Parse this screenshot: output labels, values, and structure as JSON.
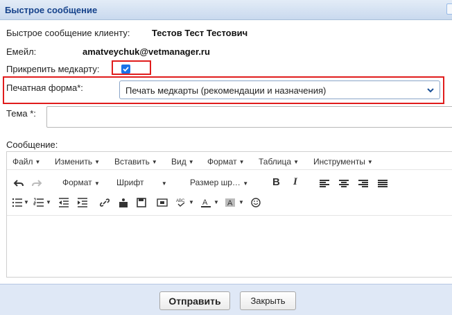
{
  "window": {
    "title": "Быстрое сообщение"
  },
  "form": {
    "client_label": "Быстрое сообщение клиенту:",
    "client_name": "Тестов Тест Тестович",
    "email_label": "Емейл:",
    "email_value": "amatveychuk@vetmanager.ru",
    "attach_label": "Прикрепить медкарту:",
    "attach_checked": true,
    "print_form_label": "Печатная форма*:",
    "print_form_value": "Печать медкарты (рекомендации и назначения)",
    "subject_label": "Тема *:",
    "subject_value": "",
    "message_label": "Сообщение:"
  },
  "editor": {
    "menu": [
      "Файл",
      "Изменить",
      "Вставить",
      "Вид",
      "Формат",
      "Таблица",
      "Инструменты"
    ],
    "toolbar1": {
      "format": "Формат",
      "font": "Шрифт",
      "size": "Размер шр…"
    }
  },
  "footer": {
    "send_label": "Отправить",
    "close_label": "Закрыть"
  },
  "colors": {
    "highlight": "#e01c1c",
    "title_text": "#15428b",
    "checkbox": "#1a73e8"
  }
}
